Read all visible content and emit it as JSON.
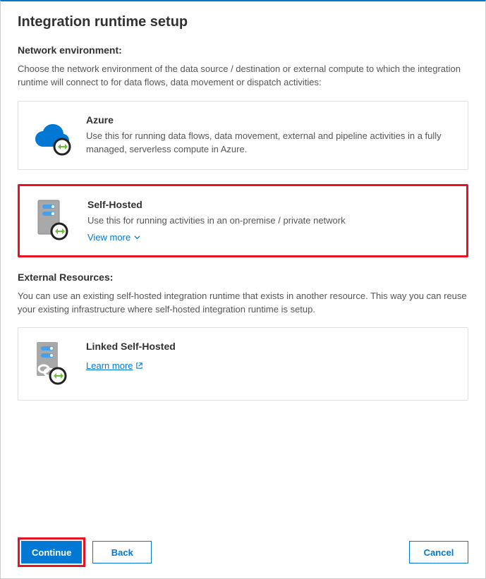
{
  "title": "Integration runtime setup",
  "network": {
    "label": "Network environment:",
    "description": "Choose the network environment of the data source / destination or external compute to which the integration runtime will connect to for data flows, data movement or dispatch activities:"
  },
  "cards": {
    "azure": {
      "title": "Azure",
      "description": "Use this for running data flows, data movement, external and pipeline activities in a fully managed, serverless compute in Azure."
    },
    "selfHosted": {
      "title": "Self-Hosted",
      "description": "Use this for running activities in an on-premise / private network",
      "viewMore": "View more"
    }
  },
  "external": {
    "label": "External Resources:",
    "description": "You can use an existing self-hosted integration runtime that exists in another resource. This way you can reuse your existing infrastructure where self-hosted integration runtime is setup."
  },
  "linked": {
    "title": "Linked Self-Hosted",
    "learnMore": "Learn more"
  },
  "footer": {
    "continue": "Continue",
    "back": "Back",
    "cancel": "Cancel"
  }
}
